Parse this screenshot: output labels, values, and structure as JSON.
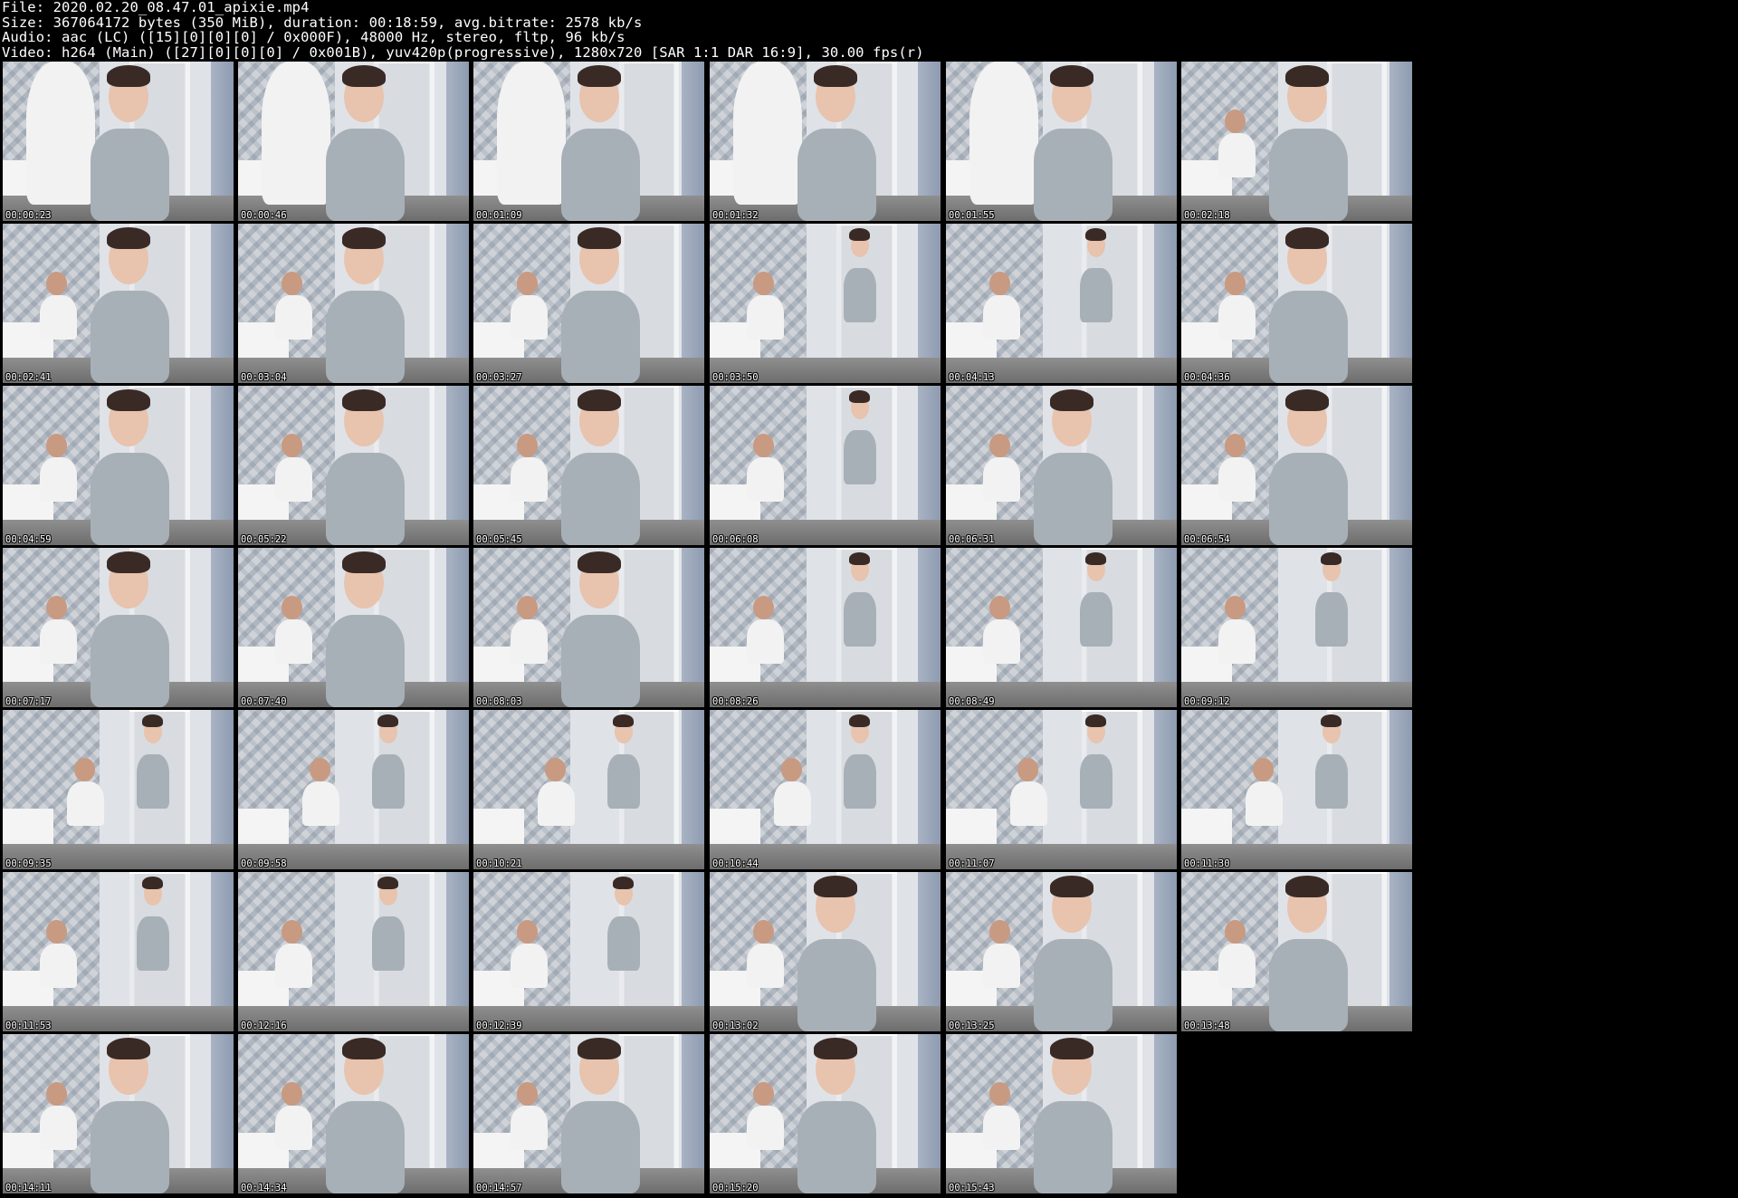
{
  "header": {
    "file_line": "File: 2020.02.20_08.47.01_apixie.mp4",
    "size_line": "Size: 367064172 bytes (350 MiB), duration: 00:18:59, avg.bitrate: 2578 kb/s",
    "audio_line": "Audio: aac (LC) ([15][0][0][0] / 0x000F), 48000 Hz, stereo, fltp, 96 kb/s",
    "video_line": "Video: h264 (Main) ([27][0][0][0] / 0x001B), yuv420p(progressive), 1280x720 [SAR 1:1 DAR 16:9], 30.00 fps(r)"
  },
  "colors": {
    "background": "#000000",
    "header_text": "#ffffff",
    "wall": "#dfe3e8",
    "wall_accent": "#a9b3c4",
    "shirt": "#a8b0b7",
    "skin": "#e8c3ad",
    "hair": "#3a2a25"
  },
  "thumbnails": [
    {
      "time": "00:00:23"
    },
    {
      "time": "00:00:46"
    },
    {
      "time": "00:01:09"
    },
    {
      "time": "00:01:32"
    },
    {
      "time": "00:01:55"
    },
    {
      "time": "00:02:18"
    },
    {
      "time": "00:02:41"
    },
    {
      "time": "00:03:04"
    },
    {
      "time": "00:03:27"
    },
    {
      "time": "00:03:50"
    },
    {
      "time": "00:04:13"
    },
    {
      "time": "00:04:36"
    },
    {
      "time": "00:04:59"
    },
    {
      "time": "00:05:22"
    },
    {
      "time": "00:05:45"
    },
    {
      "time": "00:06:08"
    },
    {
      "time": "00:06:31"
    },
    {
      "time": "00:06:54"
    },
    {
      "time": "00:07:17"
    },
    {
      "time": "00:07:40"
    },
    {
      "time": "00:08:03"
    },
    {
      "time": "00:08:26"
    },
    {
      "time": "00:08:49"
    },
    {
      "time": "00:09:12"
    },
    {
      "time": "00:09:35"
    },
    {
      "time": "00:09:58"
    },
    {
      "time": "00:10:21"
    },
    {
      "time": "00:10:44"
    },
    {
      "time": "00:11:07"
    },
    {
      "time": "00:11:30"
    },
    {
      "time": "00:11:53"
    },
    {
      "time": "00:12:16"
    },
    {
      "time": "00:12:39"
    },
    {
      "time": "00:13:02"
    },
    {
      "time": "00:13:25"
    },
    {
      "time": "00:13:48"
    },
    {
      "time": "00:14:11"
    },
    {
      "time": "00:14:34"
    },
    {
      "time": "00:14:57"
    },
    {
      "time": "00:15:20"
    },
    {
      "time": "00:15:43"
    }
  ]
}
